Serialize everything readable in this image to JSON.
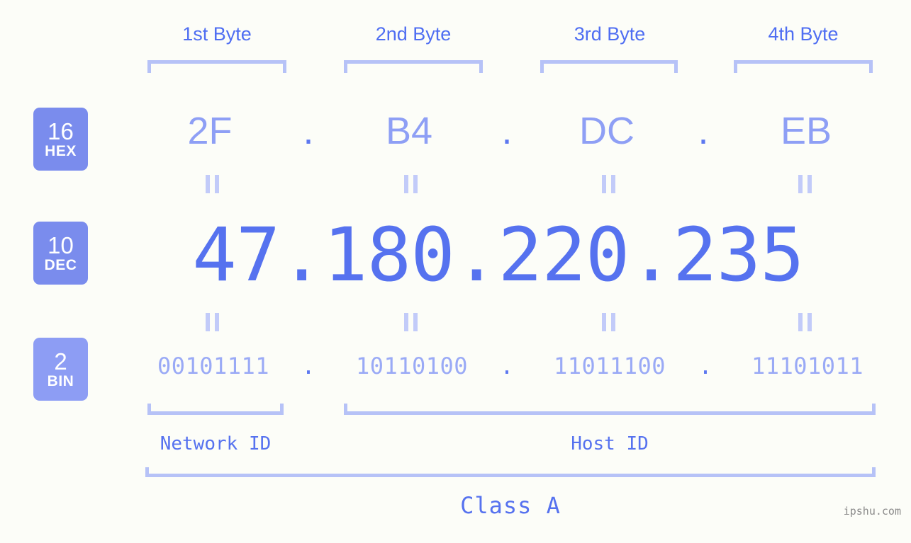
{
  "page": {
    "background": "#fcfdf8",
    "accent": "#5672ef",
    "accent_light": "#8e9ff5",
    "bracket_color": "#b6c2f7",
    "watermark": "ipshu.com"
  },
  "byte_headers": [
    {
      "label": "1st Byte"
    },
    {
      "label": "2nd Byte"
    },
    {
      "label": "3rd Byte"
    },
    {
      "label": "4th Byte"
    }
  ],
  "bases": [
    {
      "number": "16",
      "name": "HEX",
      "color": "#7a8ced"
    },
    {
      "number": "10",
      "name": "DEC",
      "color": "#7a8ced"
    },
    {
      "number": "2",
      "name": "BIN",
      "color": "#8d9df4"
    }
  ],
  "rows": {
    "hex": {
      "values": [
        "2F",
        "B4",
        "DC",
        "EB"
      ],
      "separator": "."
    },
    "dec": {
      "values": [
        "47",
        "180",
        "220",
        "235"
      ],
      "separator": ".",
      "full": "47.180.220.235"
    },
    "bin": {
      "values": [
        "00101111",
        "10110100",
        "11011100",
        "11101011"
      ],
      "separator": "."
    }
  },
  "sections": {
    "network_id": "Network ID",
    "host_id": "Host ID",
    "class": "Class A"
  }
}
